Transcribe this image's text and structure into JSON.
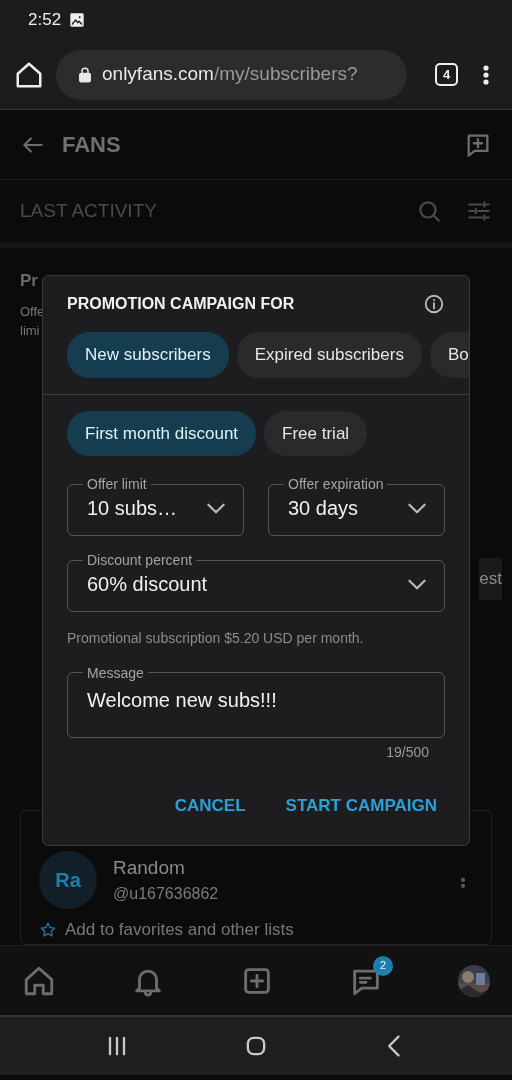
{
  "status_bar": {
    "time": "2:52"
  },
  "browser": {
    "url_host": "onlyfans.com",
    "url_path": "/my/subscribers?",
    "tab_count": "4"
  },
  "header": {
    "title": "FANS"
  },
  "toolbar": {
    "label": "LAST ACTIVITY"
  },
  "background_fragments": {
    "left": [
      "Pr",
      "Offe",
      "limi"
    ],
    "right": [
      "est"
    ]
  },
  "dialog": {
    "title": "PROMOTION CAMPAIGN FOR",
    "audiences": [
      {
        "label": "New subscribers",
        "selected": true
      },
      {
        "label": "Expired subscribers",
        "selected": false
      },
      {
        "label": "Bo",
        "selected": false
      }
    ],
    "offer_types": [
      {
        "label": "First month discount",
        "selected": true
      },
      {
        "label": "Free trial",
        "selected": false
      }
    ],
    "selects": [
      {
        "label": "Offer limit",
        "value": "10 subs…"
      },
      {
        "label": "Offer expiration",
        "value": "30 days"
      },
      {
        "label": "Discount percent",
        "value": "60% discount"
      }
    ],
    "note": "Promotional subscription $5.20 USD per month.",
    "message": {
      "label": "Message",
      "value": "Welcome new subs!!!",
      "counter": "19/500"
    },
    "buttons": [
      "CANCEL",
      "START CAMPAIGN"
    ]
  },
  "fan_card": {
    "initials": "Ra",
    "name": "Random",
    "handle": "@u167636862",
    "action": "Add to favorites and other lists"
  },
  "bottom_nav": {
    "messages_badge": "2"
  }
}
